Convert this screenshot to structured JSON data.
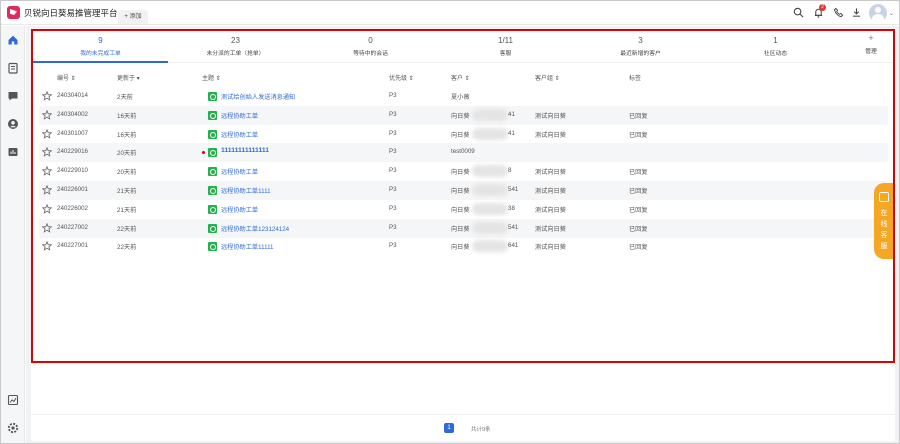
{
  "header": {
    "app_title": "贝锐向日葵易推管理平台",
    "add_tab_label": "+ 添加",
    "notification_count": "2",
    "icons": [
      "search-icon",
      "bell-icon",
      "phone-icon",
      "download-icon",
      "avatar"
    ]
  },
  "sidebar": {
    "items": [
      {
        "name": "home-icon",
        "active": true
      },
      {
        "name": "ticket-icon",
        "active": false
      },
      {
        "name": "chat-icon",
        "active": false
      },
      {
        "name": "customer-icon",
        "active": false
      },
      {
        "name": "report-icon",
        "active": false
      }
    ],
    "bottom": [
      {
        "name": "stats-icon"
      },
      {
        "name": "settings-icon"
      }
    ]
  },
  "tabs": [
    {
      "count": "9",
      "label": "我的未完成工单",
      "active": true
    },
    {
      "count": "23",
      "label": "未分派的工单（抢单）",
      "active": false
    },
    {
      "count": "0",
      "label": "等待中的会话",
      "active": false
    },
    {
      "count": "1/11",
      "label": "客服",
      "active": false
    },
    {
      "count": "3",
      "label": "最近新增的客户",
      "active": false
    },
    {
      "count": "1",
      "label": "社区动态",
      "active": false
    }
  ],
  "manage": {
    "plus": "+",
    "label": "管理"
  },
  "table": {
    "headers": {
      "id": "编号 ⇕",
      "updated": "更新于 ▾",
      "subject": "主题 ⇕",
      "priority": "优先级 ⇕",
      "customer": "客户 ⇕",
      "customer_group": "客户组 ⇕",
      "tags": "标签"
    },
    "rows": [
      {
        "id": "240304014",
        "updated": "2天前",
        "subject": "测试给创始人发送消息通知",
        "priority": "P3",
        "customer": "夏小薇",
        "group": "",
        "tag": "",
        "unread": false,
        "masked": false
      },
      {
        "id": "240304002",
        "updated": "16天前",
        "subject": "远程协助工单",
        "priority": "P3",
        "customer": "向日葵",
        "customer_tail": "41",
        "group": "测试向日葵",
        "tag": "已回复",
        "unread": false,
        "masked": true
      },
      {
        "id": "240301007",
        "updated": "16天前",
        "subject": "远程协助工单",
        "priority": "P3",
        "customer": "向日葵",
        "customer_tail": "41",
        "group": "测试向日葵",
        "tag": "已回复",
        "unread": false,
        "masked": true
      },
      {
        "id": "240229016",
        "updated": "20天前",
        "subject": "11111111111111",
        "priority": "P3",
        "customer": "test0009",
        "group": "",
        "tag": "",
        "unread": true,
        "masked": false
      },
      {
        "id": "240229010",
        "updated": "20天前",
        "subject": "远程协助工单",
        "priority": "P3",
        "customer": "向日葵",
        "customer_tail": "8",
        "group": "测试向日葵",
        "tag": "已回复",
        "unread": false,
        "masked": true
      },
      {
        "id": "240226001",
        "updated": "21天前",
        "subject": "远程协助工单1111",
        "priority": "P3",
        "customer": "向日葵",
        "customer_tail": "541",
        "group": "测试向日葵",
        "tag": "已回复",
        "unread": false,
        "masked": true
      },
      {
        "id": "240226002",
        "updated": "21天前",
        "subject": "远程协助工单",
        "priority": "P3",
        "customer": "向日葵",
        "customer_tail": "38",
        "group": "测试向日葵",
        "tag": "已回复",
        "unread": false,
        "masked": true
      },
      {
        "id": "240227002",
        "updated": "22天前",
        "subject": "远程协助工单123124124",
        "priority": "P3",
        "customer": "向日葵",
        "customer_tail": "541",
        "group": "测试向日葵",
        "tag": "已回复",
        "unread": false,
        "masked": true
      },
      {
        "id": "240227001",
        "updated": "22天前",
        "subject": "远程协助工单11111",
        "priority": "P3",
        "customer": "向日葵",
        "customer_tail": "641",
        "group": "测试向日葵",
        "tag": "已回复",
        "unread": false,
        "masked": true
      }
    ]
  },
  "float_service": {
    "label": "在线客服"
  },
  "pagination": {
    "current_page": "1",
    "total_text": "共计9条"
  },
  "colors": {
    "accent": "#2f6bd8",
    "ticket_icon": "#22b14c",
    "service": "#f5a623",
    "annotation_box": "#dd0000"
  }
}
